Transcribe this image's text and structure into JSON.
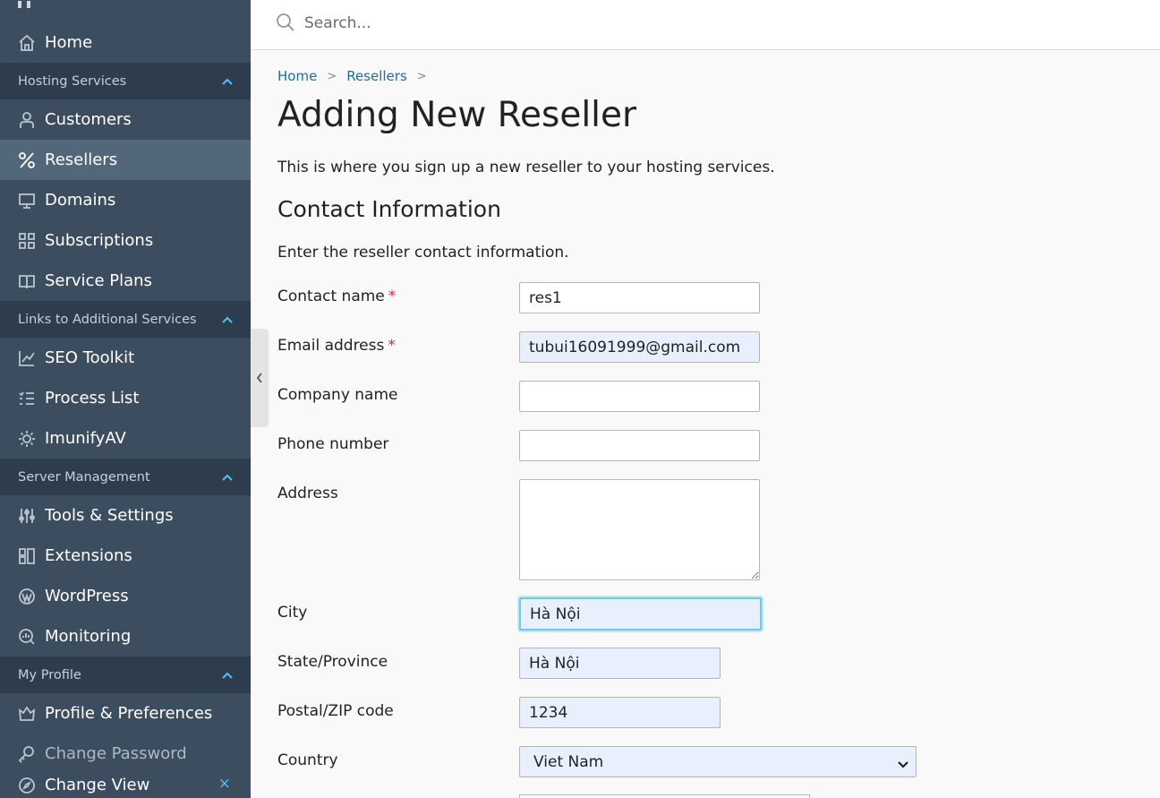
{
  "search": {
    "placeholder": "Search..."
  },
  "sidebar": {
    "home": "Home",
    "sections": {
      "hosting": "Hosting Services",
      "links": "Links to Additional Services",
      "server": "Server Management",
      "profile": "My Profile"
    },
    "hosting_items": [
      "Customers",
      "Resellers",
      "Domains",
      "Subscriptions",
      "Service Plans"
    ],
    "links_items": [
      "SEO Toolkit",
      "Process List",
      "ImunifyAV"
    ],
    "server_items": [
      "Tools & Settings",
      "Extensions",
      "WordPress",
      "Monitoring"
    ],
    "profile_items": [
      "Profile & Preferences",
      "Change Password"
    ],
    "change_view": "Change View",
    "close_symbol": "×"
  },
  "breadcrumb": {
    "home": "Home",
    "resellers": "Resellers"
  },
  "page": {
    "title": "Adding New Reseller",
    "intro": "This is where you sign up a new reseller to your hosting services."
  },
  "contact": {
    "title": "Contact Information",
    "description": "Enter the reseller contact information.",
    "required_mark": "*",
    "fields": {
      "contact_name": {
        "label": "Contact name",
        "value": "res1"
      },
      "email": {
        "label": "Email address",
        "value": "tubui16091999@gmail.com"
      },
      "company": {
        "label": "Company name",
        "value": ""
      },
      "phone": {
        "label": "Phone number",
        "value": ""
      },
      "address": {
        "label": "Address",
        "value": ""
      },
      "city": {
        "label": "City",
        "value": "Hà Nội"
      },
      "state": {
        "label": "State/Province",
        "value": "Hà Nội"
      },
      "postal": {
        "label": "Postal/ZIP code",
        "value": "1234"
      },
      "country": {
        "label": "Country",
        "value": "Viet Nam"
      }
    }
  }
}
